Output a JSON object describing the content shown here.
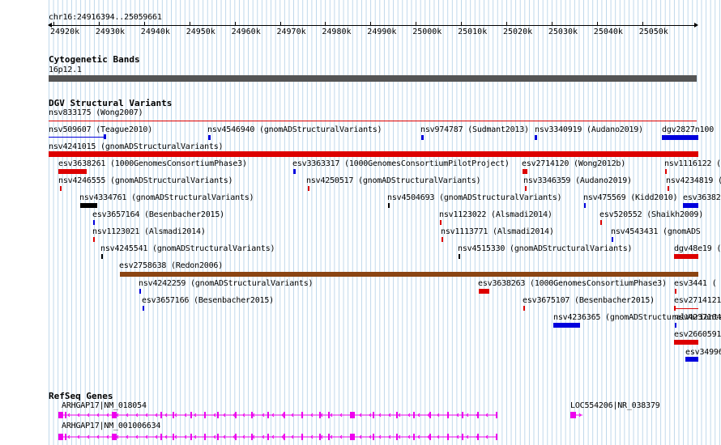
{
  "position": "chr16:24916394..25059661",
  "ruler_ticks": [
    "24920k",
    "24930k",
    "24940k",
    "24950k",
    "24960k",
    "24970k",
    "24980k",
    "24990k",
    "25000k",
    "25010k",
    "25020k",
    "25030k",
    "25040k",
    "25050k"
  ],
  "tracks": {
    "cytoband_title": "Cytogenetic Bands",
    "cytoband_label": "16p12.1",
    "dgv_title": "DGV Structural Variants",
    "refseq_title": "RefSeq Genes"
  },
  "colors": {
    "loss": "#dd0000",
    "gain": "#0000dd",
    "inversion": "#000000",
    "complex": "#8b4513",
    "cytoband": "#555555",
    "refseq": "#ee00ee",
    "grid": "#bcd6ea"
  },
  "variants": [
    {
      "label": "nsv833175 (Wong2007)"
    },
    {
      "label": "nsv509607 (Teague2010)"
    },
    {
      "label": "nsv4546940 (gnomADStructuralVariants)"
    },
    {
      "label": "nsv974787 (Sudmant2013)"
    },
    {
      "label": "nsv3340919 (Audano2019)"
    },
    {
      "label": "dgv2827n100"
    },
    {
      "label": "nsv4241015 (gnomADStructuralVariants)"
    },
    {
      "label": "esv3638261 (1000GenomesConsortiumPhase3)"
    },
    {
      "label": "esv3363317 (1000GenomesConsortiumPilotProject)"
    },
    {
      "label": "esv2714120 (Wong2012b)"
    },
    {
      "label": "nsv1116122 ("
    },
    {
      "label": "nsv4246555 (gnomADStructuralVariants)"
    },
    {
      "label": "nsv4250517 (gnomADStructuralVariants)"
    },
    {
      "label": "nsv3346359 (Audano2019)"
    },
    {
      "label": "nsv4234819 ("
    },
    {
      "label": "nsv4334761 (gnomADStructuralVariants)"
    },
    {
      "label": "nsv4504693 (gnomADStructuralVariants)"
    },
    {
      "label": "nsv475569 (Kidd2010)"
    },
    {
      "label": "esv36382"
    },
    {
      "label": "esv3657164 (Besenbacher2015)"
    },
    {
      "label": "nsv1123022 (Alsmadi2014)"
    },
    {
      "label": "esv520552 (Shaikh2009)"
    },
    {
      "label": "nsv1123021 (Alsmadi2014)"
    },
    {
      "label": "nsv1113771 (Alsmadi2014)"
    },
    {
      "label": "nsv4543431 (gnomADS"
    },
    {
      "label": "nsv4245541 (gnomADStructuralVariants)"
    },
    {
      "label": "nsv4515330 (gnomADStructuralVariants)"
    },
    {
      "label": "dgv48e19 ("
    },
    {
      "label": "esv2758638 (Redon2006)"
    },
    {
      "label": "nsv4242259 (gnomADStructuralVariants)"
    },
    {
      "label": "esv3638263 (1000GenomesConsortiumPhase3)"
    },
    {
      "label": "esv3441 ("
    },
    {
      "label": "esv3657166 (Besenbacher2015)"
    },
    {
      "label": "esv3675107 (Besenbacher2015)"
    },
    {
      "label": "esv2714121"
    },
    {
      "label": "nsv4236365 (gnomADStructuralVariants)"
    },
    {
      "label": "nsv4237104 (gnomADStructuralVariant"
    },
    {
      "label": "esv2660591"
    },
    {
      "label": "esv34996"
    }
  ],
  "genes": [
    {
      "label": "ARHGAP17|NM_018054"
    },
    {
      "label": "ARHGAP17|NM_001006634"
    },
    {
      "label": "LOC554206|NR_038379"
    }
  ]
}
